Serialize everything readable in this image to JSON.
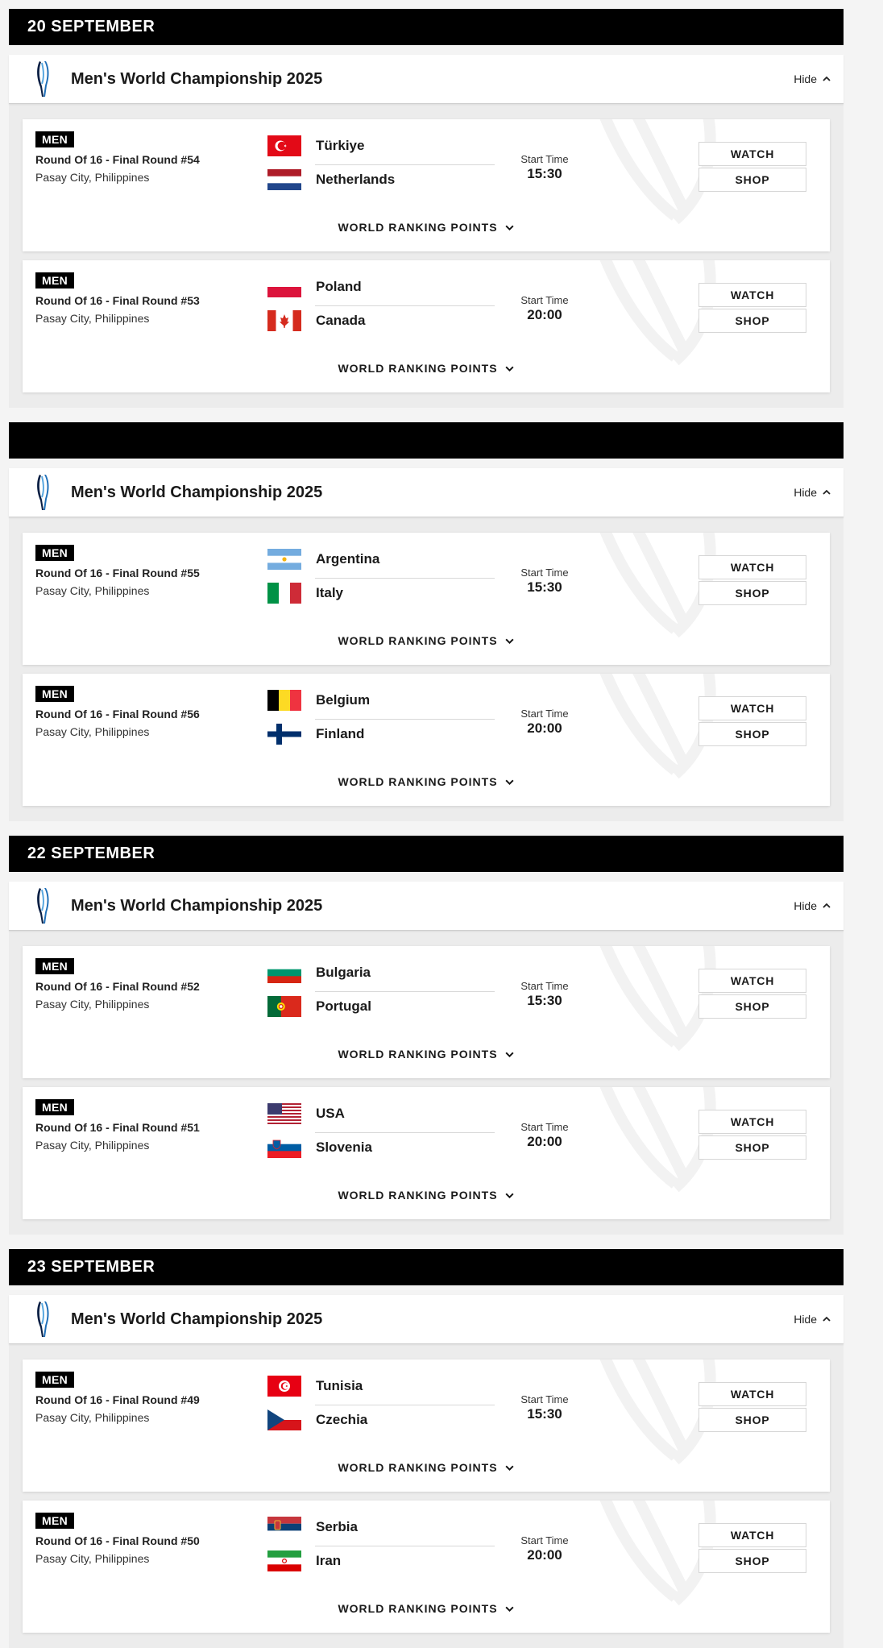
{
  "days": [
    {
      "date": "20 SEPTEMBER",
      "competition": "Men's World Championship 2025",
      "hide_label": "Hide",
      "matches": [
        {
          "gender": "MEN",
          "round": "Round Of 16 - Final Round #54",
          "venue": "Pasay City, Philippines",
          "home": "Türkiye",
          "home_flag": "turkey",
          "away": "Netherlands",
          "away_flag": "netherlands",
          "start_label": "Start Time",
          "start_time": "15:30",
          "watch": "WATCH",
          "shop": "SHOP",
          "wrp": "WORLD RANKING POINTS"
        },
        {
          "gender": "MEN",
          "round": "Round Of 16 - Final Round #53",
          "venue": "Pasay City, Philippines",
          "home": "Poland",
          "home_flag": "poland",
          "away": "Canada",
          "away_flag": "canada",
          "start_label": "Start Time",
          "start_time": "20:00",
          "watch": "WATCH",
          "shop": "SHOP",
          "wrp": "WORLD RANKING POINTS"
        }
      ]
    },
    {
      "date": "",
      "competition": "Men's World Championship 2025",
      "hide_label": "Hide",
      "matches": [
        {
          "gender": "MEN",
          "round": "Round Of 16 - Final Round #55",
          "venue": "Pasay City, Philippines",
          "home": "Argentina",
          "home_flag": "argentina",
          "away": "Italy",
          "away_flag": "italy",
          "start_label": "Start Time",
          "start_time": "15:30",
          "watch": "WATCH",
          "shop": "SHOP",
          "wrp": "WORLD RANKING POINTS"
        },
        {
          "gender": "MEN",
          "round": "Round Of 16 - Final Round #56",
          "venue": "Pasay City, Philippines",
          "home": "Belgium",
          "home_flag": "belgium",
          "away": "Finland",
          "away_flag": "finland",
          "start_label": "Start Time",
          "start_time": "20:00",
          "watch": "WATCH",
          "shop": "SHOP",
          "wrp": "WORLD RANKING POINTS"
        }
      ]
    },
    {
      "date": "22 SEPTEMBER",
      "competition": "Men's World Championship 2025",
      "hide_label": "Hide",
      "matches": [
        {
          "gender": "MEN",
          "round": "Round Of 16 - Final Round #52",
          "venue": "Pasay City, Philippines",
          "home": "Bulgaria",
          "home_flag": "bulgaria",
          "away": "Portugal",
          "away_flag": "portugal",
          "start_label": "Start Time",
          "start_time": "15:30",
          "watch": "WATCH",
          "shop": "SHOP",
          "wrp": "WORLD RANKING POINTS"
        },
        {
          "gender": "MEN",
          "round": "Round Of 16 - Final Round #51",
          "venue": "Pasay City, Philippines",
          "home": "USA",
          "home_flag": "usa",
          "away": "Slovenia",
          "away_flag": "slovenia",
          "start_label": "Start Time",
          "start_time": "20:00",
          "watch": "WATCH",
          "shop": "SHOP",
          "wrp": "WORLD RANKING POINTS"
        }
      ]
    },
    {
      "date": "23 SEPTEMBER",
      "competition": "Men's World Championship 2025",
      "hide_label": "Hide",
      "matches": [
        {
          "gender": "MEN",
          "round": "Round Of 16 - Final Round #49",
          "venue": "Pasay City, Philippines",
          "home": "Tunisia",
          "home_flag": "tunisia",
          "away": "Czechia",
          "away_flag": "czechia",
          "start_label": "Start Time",
          "start_time": "15:30",
          "watch": "WATCH",
          "shop": "SHOP",
          "wrp": "WORLD RANKING POINTS"
        },
        {
          "gender": "MEN",
          "round": "Round Of 16 - Final Round #50",
          "venue": "Pasay City, Philippines",
          "home": "Serbia",
          "home_flag": "serbia",
          "away": "Iran",
          "away_flag": "iran",
          "start_label": "Start Time",
          "start_time": "20:00",
          "watch": "WATCH",
          "shop": "SHOP",
          "wrp": "WORLD RANKING POINTS"
        }
      ]
    }
  ],
  "colors": {
    "date_bar": "#000000",
    "section_bg": "#ececec",
    "card_bg": "#ffffff",
    "logo_blue": "#1f6fb8",
    "logo_navy": "#0a1f44"
  },
  "icons": {
    "competition_logo": "volleyball-federation-logo-icon",
    "hide_chevron": "chevron-up-icon",
    "wrp_chevron": "chevron-down-icon",
    "card_watermark": "volleyball-watermark-icon"
  }
}
